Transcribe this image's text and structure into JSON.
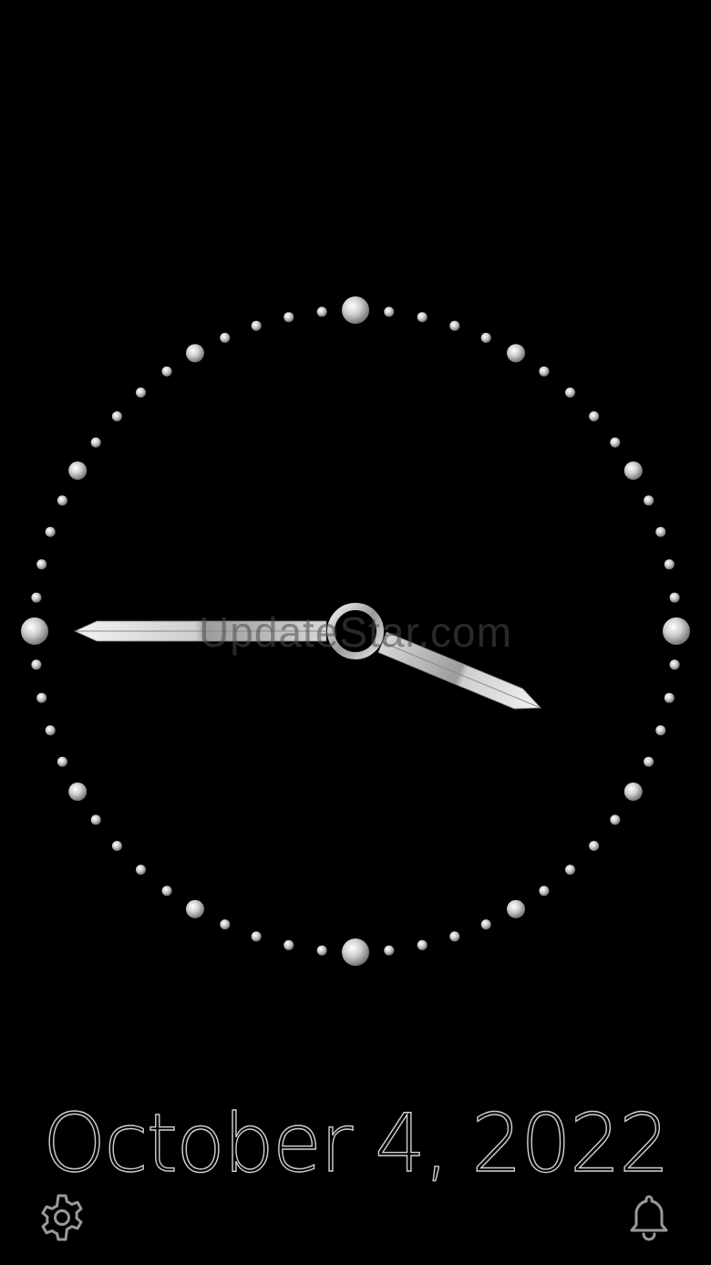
{
  "clock": {
    "hour": 3,
    "minute": 45,
    "face_color": "#000000",
    "marker_color": "#d0d0d0",
    "hand_color": "#c8c8c8"
  },
  "watermark": {
    "text": "UpdateStar.com"
  },
  "date": {
    "text": "October 4, 2022"
  },
  "toolbar": {
    "settings_icon": "gear-icon",
    "alarm_icon": "bell-icon"
  }
}
